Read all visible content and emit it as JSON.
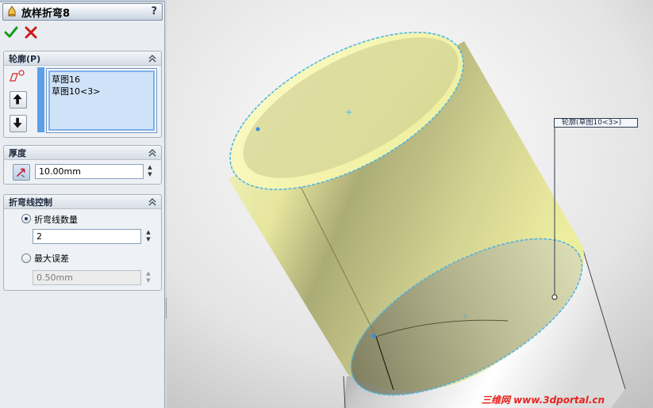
{
  "feature": {
    "title": "放样折弯8",
    "help": "?",
    "icon": "lofted-bend-icon"
  },
  "actions": {
    "ok_icon": "checkmark-icon",
    "cancel_icon": "cross-icon"
  },
  "profile_group": {
    "title": "轮廓(P)",
    "items": [
      "草图16",
      "草图10<3>"
    ],
    "icon": "profile-sketch-icon"
  },
  "thickness_group": {
    "title": "厚度",
    "value": "10.00mm"
  },
  "bend_group": {
    "title": "折弯线控制",
    "option1_label": "折弯线数量",
    "option1_value": "2",
    "option1_selected": true,
    "option2_label": "最大误差",
    "option2_value": "0.50mm",
    "option2_selected": false
  },
  "viewport": {
    "callout": "轮廓(草图10<3>)",
    "watermark": "三维网 www.3dportal.cn"
  },
  "colors": {
    "preview_yellow": "#e6e67a",
    "edge_cyan": "#4fb6e0",
    "pm_background": "#e9ecf1"
  }
}
